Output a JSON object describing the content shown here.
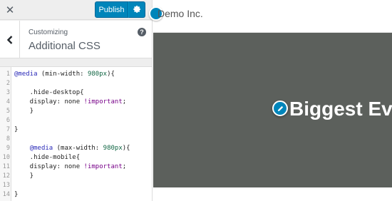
{
  "topbar": {
    "close_icon": "close-icon",
    "publish_label": "Publish",
    "settings_icon": "gear-icon",
    "accent": "#0085ba"
  },
  "section": {
    "breadcrumb": "Customizing",
    "title": "Additional CSS",
    "back_icon": "chevron-left-icon",
    "help_icon": "help-icon"
  },
  "editor": {
    "lines": [
      {
        "n": "1",
        "segments": [
          {
            "t": "@media",
            "c": "at"
          },
          {
            "t": " (min-width: ",
            "c": ""
          },
          {
            "t": "980px",
            "c": "num"
          },
          {
            "t": "){",
            "c": ""
          }
        ]
      },
      {
        "n": "2",
        "segments": []
      },
      {
        "n": "3",
        "segments": [
          {
            "t": "    .hide-desktop{",
            "c": ""
          }
        ]
      },
      {
        "n": "4",
        "segments": [
          {
            "t": "    display: none ",
            "c": ""
          },
          {
            "t": "!important",
            "c": "kw"
          },
          {
            "t": ";",
            "c": ""
          }
        ]
      },
      {
        "n": "5",
        "segments": [
          {
            "t": "    }",
            "c": ""
          }
        ]
      },
      {
        "n": "6",
        "segments": []
      },
      {
        "n": "7",
        "segments": [
          {
            "t": "}",
            "c": ""
          }
        ]
      },
      {
        "n": "8",
        "segments": []
      },
      {
        "n": "9",
        "segments": [
          {
            "t": "    ",
            "c": ""
          },
          {
            "t": "@media",
            "c": "at"
          },
          {
            "t": " (max-width: ",
            "c": ""
          },
          {
            "t": "980px",
            "c": "num"
          },
          {
            "t": "){",
            "c": ""
          }
        ]
      },
      {
        "n": "10",
        "segments": [
          {
            "t": "    .hide-mobile{",
            "c": ""
          }
        ]
      },
      {
        "n": "11",
        "segments": [
          {
            "t": "    display: none ",
            "c": ""
          },
          {
            "t": "!important",
            "c": "kw"
          },
          {
            "t": ";",
            "c": ""
          }
        ]
      },
      {
        "n": "12",
        "segments": [
          {
            "t": "    }",
            "c": ""
          }
        ]
      },
      {
        "n": "13",
        "segments": []
      },
      {
        "n": "14",
        "segments": [
          {
            "t": "}",
            "c": ""
          }
        ]
      }
    ]
  },
  "preview": {
    "site_title": "Demo Inc.",
    "hero_title": "Biggest Ev",
    "edit_icon": "pencil-icon",
    "hero_color": "#5c605c"
  }
}
